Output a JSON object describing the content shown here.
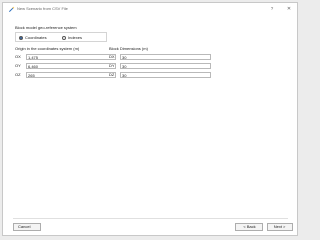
{
  "window": {
    "title": "New Scenario from CSV File",
    "help_label": "?",
    "close_label": "✕",
    "icon": "wand-icon"
  },
  "georef": {
    "label": "Block model geo-reference system",
    "options": [
      {
        "label": "Coordinates",
        "selected": true
      },
      {
        "label": "Indexes",
        "selected": false
      }
    ]
  },
  "origin": {
    "label": "Origin in the coordinates system (m)",
    "fields": [
      {
        "label": "OX",
        "value": "1,475"
      },
      {
        "label": "OY",
        "value": "6,460"
      },
      {
        "label": "OZ",
        "value": "265"
      }
    ]
  },
  "dimensions": {
    "label": "Block Dimensions (m)",
    "fields": [
      {
        "label": "DX",
        "value": "30"
      },
      {
        "label": "DY",
        "value": "30"
      },
      {
        "label": "DZ",
        "value": "30"
      }
    ]
  },
  "footer": {
    "cancel_label": "Cancel",
    "back_label": "Back",
    "next_label": "Next",
    "back_arrow": "<",
    "next_arrow": ">"
  }
}
